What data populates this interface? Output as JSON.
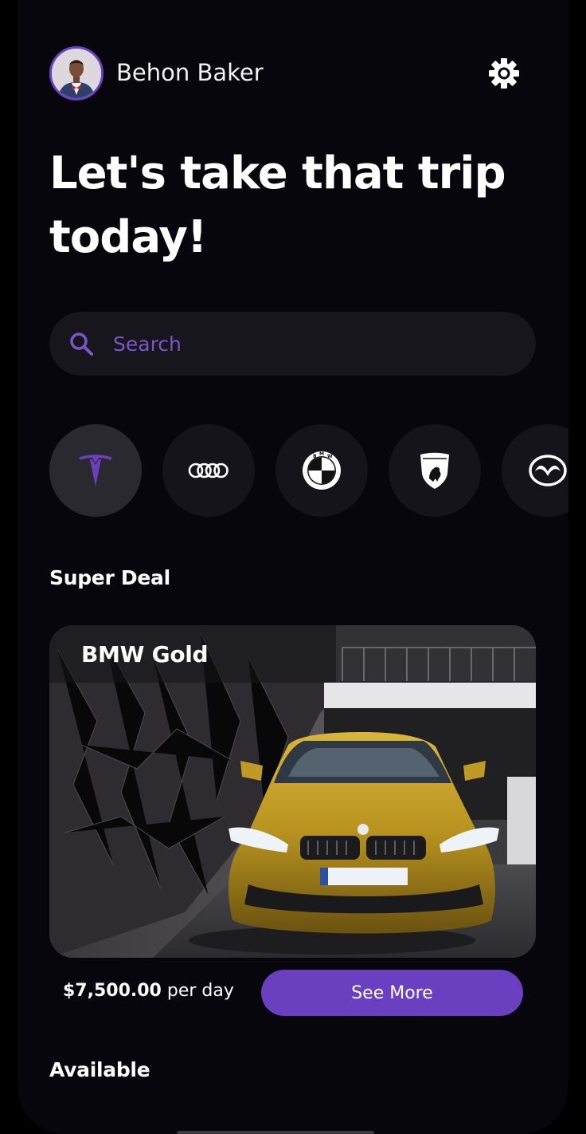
{
  "header": {
    "user_name": "Behon Baker",
    "settings_icon": "gear-icon"
  },
  "headline": "Let's take that trip today!",
  "search": {
    "placeholder": "Search",
    "value": ""
  },
  "brands": [
    {
      "name": "tesla-logo-icon",
      "active": true
    },
    {
      "name": "audi-logo-icon",
      "active": false
    },
    {
      "name": "bmw-logo-icon",
      "active": false
    },
    {
      "name": "lamborghini-logo-icon",
      "active": false
    },
    {
      "name": "mazda-logo-icon",
      "active": false
    }
  ],
  "super_deal": {
    "section_title": "Super Deal",
    "car_name": "BMW Gold",
    "price": "$7,500.00",
    "price_unit": "per day",
    "cta_label": "See More"
  },
  "available": {
    "section_title": "Available"
  },
  "colors": {
    "accent": "#6a3fc0",
    "background": "#07060d",
    "card": "#15141b"
  }
}
